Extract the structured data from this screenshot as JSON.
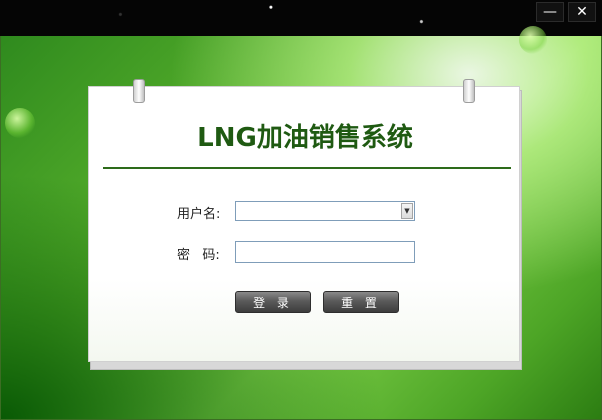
{
  "window": {
    "minimize_label": "—",
    "close_label": "✕"
  },
  "login": {
    "title": "LNG加油销售系统",
    "username_label": "用户名:",
    "username_value": "",
    "password_label": "密   码:",
    "password_value": "",
    "login_button": "登 录",
    "reset_button": "重 置"
  },
  "colors": {
    "title": "#1f5a12",
    "accent": "#2d6b1a",
    "background": "#58b12c"
  }
}
